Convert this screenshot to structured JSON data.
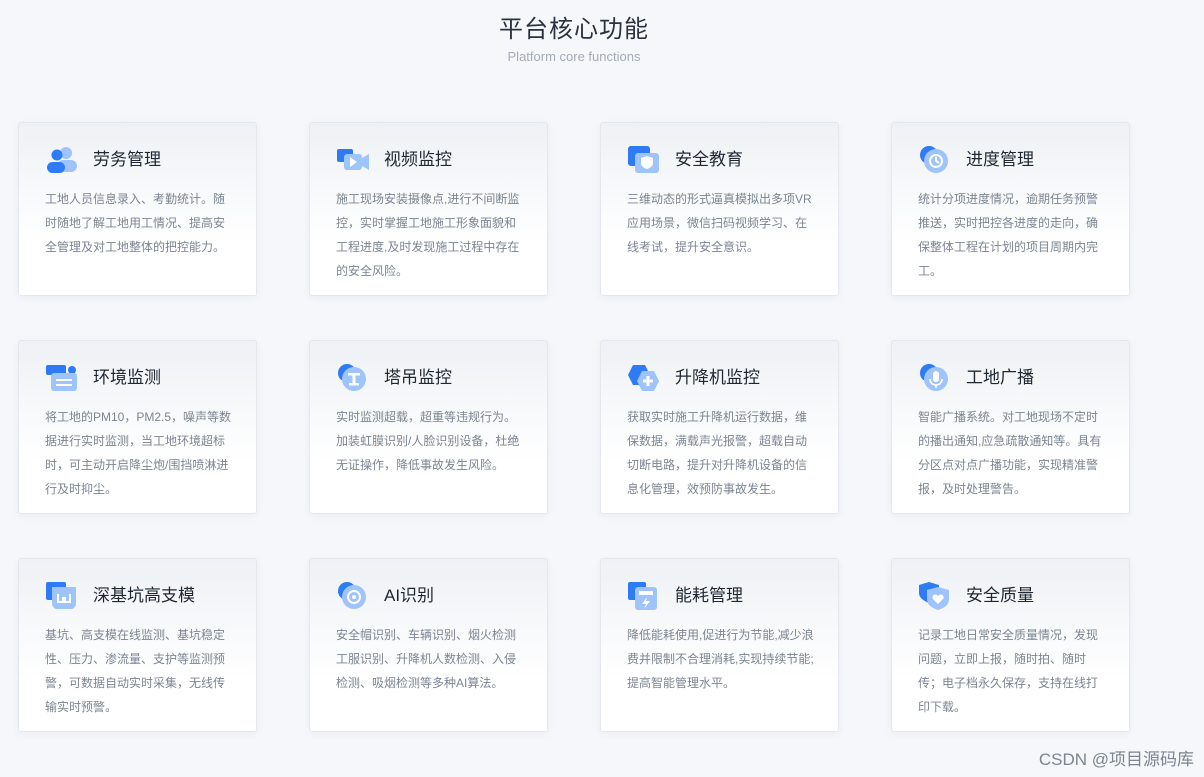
{
  "header": {
    "title": "平台核心功能",
    "subtitle": "Platform core functions"
  },
  "colors": {
    "accent": "#2e7bf6",
    "accent_light": "#9fc3fb",
    "background": "#f5f7fa"
  },
  "cards": [
    {
      "icon": "workers-icon",
      "title": "劳务管理",
      "desc": "工地人员信息录入、考勤统计。随时随地了解工地用工情况、提高安全管理及对工地整体的把控能力。"
    },
    {
      "icon": "video-camera-icon",
      "title": "视频监控",
      "desc": "施工现场安装摄像点,进行不间断监控，实时掌握工地施工形象面貌和工程进度,及时发现施工过程中存在的安全风险。"
    },
    {
      "icon": "shield-screen-icon",
      "title": "安全教育",
      "desc": "三维动态的形式逼真模拟出多项VR应用场景，微信扫码视频学习、在线考试，提升安全意识。"
    },
    {
      "icon": "clock-icon",
      "title": "进度管理",
      "desc": "统计分项进度情况，逾期任务预警推送，实时把控各进度的走向，确保整体工程在计划的项目周期内完工。"
    },
    {
      "icon": "environment-monitor-icon",
      "title": "环境监测",
      "desc": "将工地的PM10，PM2.5，噪声等数据进行实时监测，当工地环境超标时，可主动开启降尘炮/围挡喷淋进行及时抑尘。"
    },
    {
      "icon": "tower-crane-icon",
      "title": "塔吊监控",
      "desc": "实时监测超载，超重等违规行为。加装虹膜识别/人脸识别设备，杜绝无证操作，降低事故发生风险。"
    },
    {
      "icon": "hexagon-plus-icon",
      "title": "升降机监控",
      "desc": "获取实时施工升降机运行数据，维保数据，满载声光报警，超载自动切断电路，提升对升降机设备的信息化管理，效预防事故发生。"
    },
    {
      "icon": "microphone-icon",
      "title": "工地广播",
      "desc": "智能广播系统。对工地现场不定时的播出通知,应急疏散通知等。具有分区点对点广播功能，实现精准警报，及时处理警告。"
    },
    {
      "icon": "foundation-pit-icon",
      "title": "深基坑高支模",
      "desc": "基坑、高支模在线监测、基坑稳定性、压力、渗流量、支护等监测预警，可数据自动实时采集，无线传输实时预警。"
    },
    {
      "icon": "ai-eye-icon",
      "title": "AI识别",
      "desc": "安全帽识别、车辆识别、烟火检测工服识别、升降机人数检测、入侵检测、吸烟检测等多种AI算法。"
    },
    {
      "icon": "energy-meter-icon",
      "title": "能耗管理",
      "desc": "降低能耗使用,促进行为节能,减少浪费并限制不合理消耗,实现持续节能;提高智能管理水平。"
    },
    {
      "icon": "shield-heart-icon",
      "title": "安全质量",
      "desc": "记录工地日常安全质量情况，发现问题，立即上报，随时拍、随时传；电子档永久保存，支持在线打印下载。"
    }
  ],
  "watermark": "CSDN @项目源码库"
}
